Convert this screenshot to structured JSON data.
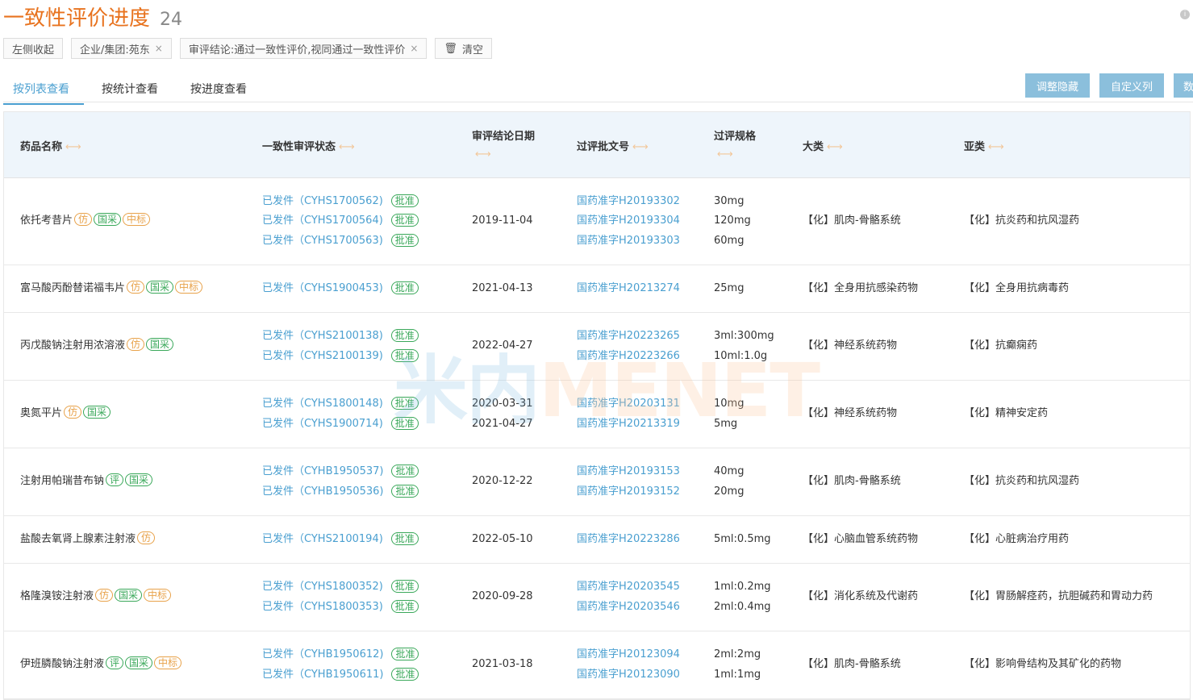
{
  "header": {
    "title": "一致性评价进度",
    "count": "24"
  },
  "filters": {
    "collapse": "左侧收起",
    "chips": [
      "企业/集团:苑东",
      "审评结论:通过一致性评价,视同通过一致性评价"
    ],
    "clear": "清空",
    "close_glyph": "×"
  },
  "tabs": [
    "按列表查看",
    "按统计查看",
    "按进度查看"
  ],
  "buttons": [
    "调整隐藏",
    "自定义列",
    "数"
  ],
  "columns": {
    "name": "药品名称",
    "status": "一致性审评状态",
    "date": "审评结论日期",
    "approval": "过评批文号",
    "spec": "过评规格",
    "category": "大类",
    "subcategory": "亚类"
  },
  "arrow_glyph": "←→",
  "approve_label": "批准",
  "watermark": {
    "a": "米内",
    "b": "MENET"
  },
  "rows": [
    {
      "name": "依托考昔片",
      "tags": [
        {
          "t": "仿",
          "c": "orange"
        },
        {
          "t": "国采",
          "c": "green"
        },
        {
          "t": "中标",
          "c": "orange"
        }
      ],
      "status": [
        "已发件（CYHS1700562)",
        "已发件（CYHS1700564)",
        "已发件（CYHS1700563)"
      ],
      "dates": [
        "2019-11-04"
      ],
      "approvals": [
        "国药准字H20193302",
        "国药准字H20193304",
        "国药准字H20193303"
      ],
      "specs": [
        "30mg",
        "120mg",
        "60mg"
      ],
      "category": "【化】肌肉-骨骼系统",
      "subcategory": "【化】抗炎药和抗风湿药"
    },
    {
      "name": "富马酸丙酚替诺福韦片",
      "tags": [
        {
          "t": "仿",
          "c": "orange"
        },
        {
          "t": "国采",
          "c": "green"
        },
        {
          "t": "中标",
          "c": "orange"
        }
      ],
      "status": [
        "已发件（CYHS1900453)"
      ],
      "dates": [
        "2021-04-13"
      ],
      "approvals": [
        "国药准字H20213274"
      ],
      "specs": [
        "25mg"
      ],
      "category": "【化】全身用抗感染药物",
      "subcategory": "【化】全身用抗病毒药"
    },
    {
      "name": "丙戊酸钠注射用浓溶液",
      "tags": [
        {
          "t": "仿",
          "c": "orange"
        },
        {
          "t": "国采",
          "c": "green"
        }
      ],
      "status": [
        "已发件（CYHS2100138)",
        "已发件（CYHS2100139)"
      ],
      "dates": [
        "2022-04-27"
      ],
      "approvals": [
        "国药准字H20223265",
        "国药准字H20223266"
      ],
      "specs": [
        "3ml:300mg",
        "10ml:1.0g"
      ],
      "category": "【化】神经系统药物",
      "subcategory": "【化】抗癫痫药"
    },
    {
      "name": "奥氮平片",
      "tags": [
        {
          "t": "仿",
          "c": "orange"
        },
        {
          "t": "国采",
          "c": "green"
        }
      ],
      "status": [
        "已发件（CYHS1800148)",
        "已发件（CYHS1900714)"
      ],
      "dates": [
        "2020-03-31",
        "2021-04-27"
      ],
      "approvals": [
        "国药准字H20203131",
        "国药准字H20213319"
      ],
      "specs": [
        "10mg",
        "5mg"
      ],
      "category": "【化】神经系统药物",
      "subcategory": "【化】精神安定药"
    },
    {
      "name": "注射用帕瑞昔布钠",
      "tags": [
        {
          "t": "评",
          "c": "green"
        },
        {
          "t": "国采",
          "c": "green"
        }
      ],
      "status": [
        "已发件（CYHB1950537)",
        "已发件（CYHB1950536)"
      ],
      "dates": [
        "2020-12-22"
      ],
      "approvals": [
        "国药准字H20193153",
        "国药准字H20193152"
      ],
      "specs": [
        "40mg",
        "20mg"
      ],
      "category": "【化】肌肉-骨骼系统",
      "subcategory": "【化】抗炎药和抗风湿药"
    },
    {
      "name": "盐酸去氧肾上腺素注射液",
      "tags": [
        {
          "t": "仿",
          "c": "orange"
        }
      ],
      "status": [
        "已发件（CYHS2100194)"
      ],
      "dates": [
        "2022-05-10"
      ],
      "approvals": [
        "国药准字H20223286"
      ],
      "specs": [
        "5ml:0.5mg"
      ],
      "category": "【化】心脑血管系统药物",
      "subcategory": "【化】心脏病治疗用药"
    },
    {
      "name": "格隆溴铵注射液",
      "tags": [
        {
          "t": "仿",
          "c": "orange"
        },
        {
          "t": "国采",
          "c": "green"
        },
        {
          "t": "中标",
          "c": "orange"
        }
      ],
      "status": [
        "已发件（CYHS1800352)",
        "已发件（CYHS1800353)"
      ],
      "dates": [
        "2020-09-28"
      ],
      "approvals": [
        "国药准字H20203545",
        "国药准字H20203546"
      ],
      "specs": [
        "1ml:0.2mg",
        "2ml:0.4mg"
      ],
      "category": "【化】消化系统及代谢药",
      "subcategory": "【化】胃肠解痉药，抗胆碱药和胃动力药"
    },
    {
      "name": "伊班膦酸钠注射液",
      "tags": [
        {
          "t": "评",
          "c": "green"
        },
        {
          "t": "国采",
          "c": "green"
        },
        {
          "t": "中标",
          "c": "orange"
        }
      ],
      "status": [
        "已发件（CYHB1950612)",
        "已发件（CYHB1950611)"
      ],
      "dates": [
        "2021-03-18"
      ],
      "approvals": [
        "国药准字H20123094",
        "国药准字H20123090"
      ],
      "specs": [
        "2ml:2mg",
        "1ml:1mg"
      ],
      "category": "【化】肌肉-骨骼系统",
      "subcategory": "【化】影响骨结构及其矿化的药物"
    }
  ]
}
